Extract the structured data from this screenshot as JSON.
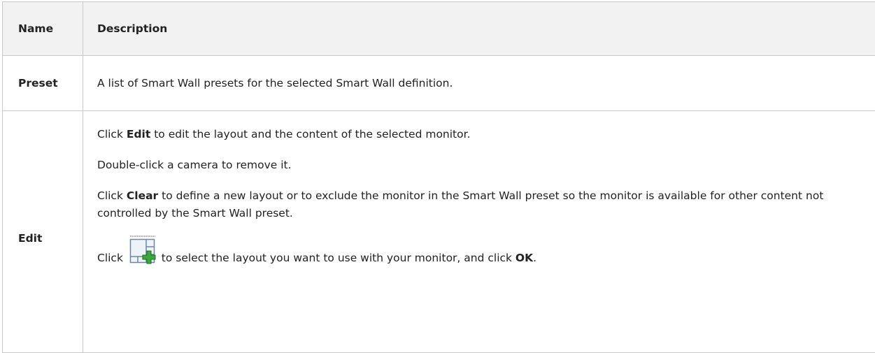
{
  "table": {
    "headers": {
      "name": "Name",
      "description": "Description"
    },
    "rows": {
      "preset": {
        "name": "Preset",
        "description": "A list of Smart Wall presets for the selected Smart Wall definition."
      },
      "edit": {
        "name": "Edit",
        "p1_pre": "Click ",
        "p1_bold": "Edit",
        "p1_post": " to edit the layout and the content of the selected monitor.",
        "p2": "Double-click a camera to remove it.",
        "p3_pre": "Click ",
        "p3_bold": "Clear",
        "p3_post": " to define a new layout or to exclude the monitor in the Smart Wall preset so the monitor is available for other content not controlled by the Smart Wall preset.",
        "p4_pre": "Click ",
        "p4_icon": "layout-add-icon",
        "p4_mid": " to select the layout you want to use with your monitor, and click ",
        "p4_bold": "OK",
        "p4_post": "."
      }
    }
  },
  "colors": {
    "header_bg": "#f2f2f2",
    "border": "#c9c9c9",
    "text": "#222222",
    "icon_plus": "#3aa83a"
  }
}
